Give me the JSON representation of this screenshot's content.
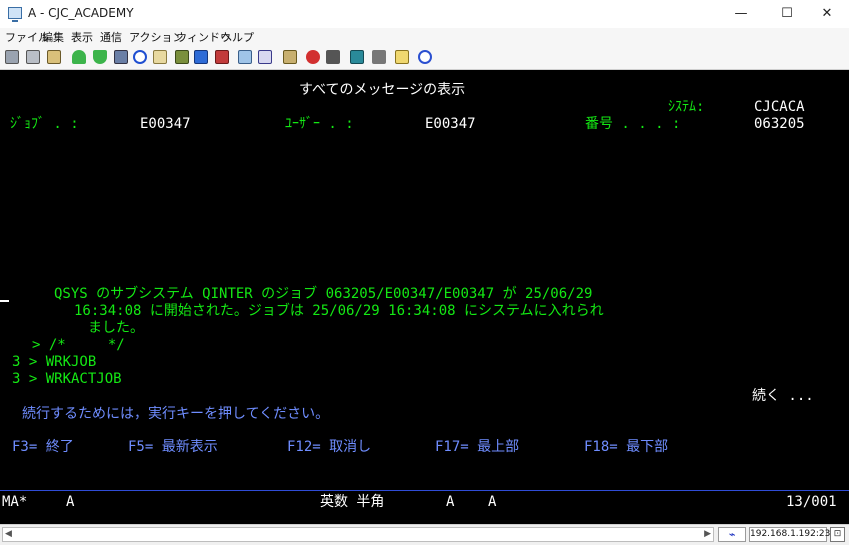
{
  "window": {
    "title": "A - CJC_ACADEMY",
    "minimize": "—",
    "maximize": "☐",
    "close": "✕"
  },
  "menu": [
    "ファイル",
    "編集",
    "表示",
    "通信",
    "アクション",
    "ウィンドウ",
    "ヘルプ"
  ],
  "toolbar": {
    "icons": [
      "copy-icon",
      "paste-icon",
      "paste-next-icon",
      "send-file-icon",
      "receive-file-icon",
      "print-screen-icon",
      "navigator-icon",
      "display-file-icon",
      "quick-keys-icon",
      "macro-icon",
      "record-macro-icon",
      "keyboard-icon",
      "customize-icon",
      "settings-icon",
      "tools-icon",
      "record-icon",
      "stop-icon",
      "play-icon",
      "pause-icon",
      "note-icon",
      "help-icon"
    ]
  },
  "screen": {
    "title": "すべてのメッセージの表示",
    "system_label": "ｼｽﾃﾑ:",
    "system_value": "CJCACA",
    "job_label": "ｼﾞｮﾌﾞ . :",
    "job_value": "E00347",
    "user_label": "ﾕｰｻﾞｰ . :",
    "user_value": "E00347",
    "number_label": "番号 . . . :",
    "number_value": "063205",
    "message_line1": "QSYS のサブシステム QINTER のジョブ 063205/E00347/E00347 が 25/06/29",
    "message_line2": "16:34:08 に開始された。ジョブは 25/06/29 16:34:08 にシステムに入れられ",
    "message_line3": "ました。",
    "cmd1": "> /*     */",
    "cmd2": "3 > WRKJOB",
    "cmd3": "3 > WRKACTJOB",
    "more": "続く ...",
    "instruction": "続行するためには，実行キーを押してください。",
    "fkeys": [
      "F3= 終了",
      "F5= 最新表示",
      "F12= 取消し",
      "F17= 最上部",
      "F18= 最下部"
    ]
  },
  "oia": {
    "mode": "MA*",
    "session": "A",
    "input_mode": "英数 半角",
    "flag1": "A",
    "flag2": "A",
    "cursor_pos": "13/001"
  },
  "status": {
    "connection_icon": "connect-icon",
    "ip": "192.168.1.192:23"
  },
  "colors": {
    "terminal_bg": "#000000",
    "green": "#14e814",
    "white": "#ffffff",
    "blue": "#6f8dff"
  }
}
